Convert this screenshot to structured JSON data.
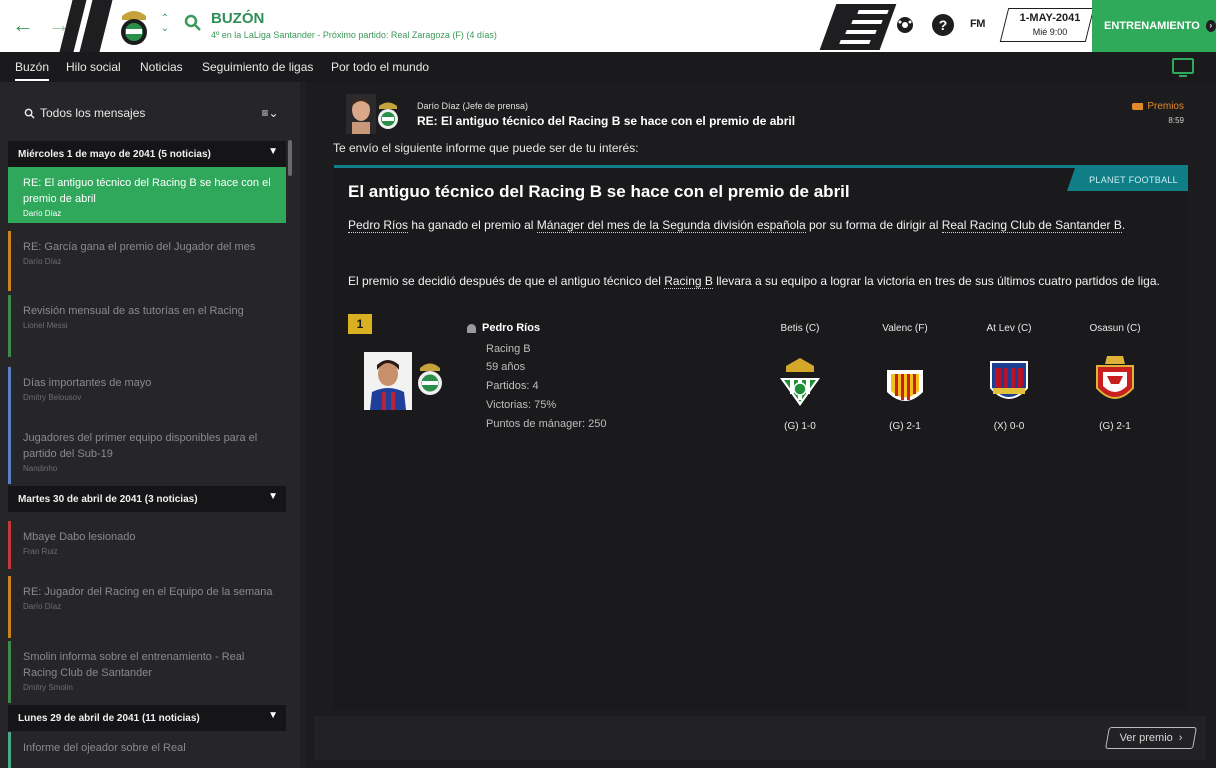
{
  "topbar": {
    "back_icon": "back-arrow-icon",
    "forward_icon": "forward-arrow-icon",
    "title": "BUZÓN",
    "subtitle": "4º en la LaLiga Santander - Próximo partido: Real Zaragoza (F) (4 días)",
    "fm_logo": "FM",
    "help_label": "?",
    "date": "1-MAY-2041",
    "day_time": "Mié 9:00",
    "continue_label": "ENTRENAMIENTO",
    "continue_icon": "›",
    "accent": "#2faa5a"
  },
  "subnav": {
    "tabs": [
      "Buzón",
      "Hilo social",
      "Noticias",
      "Seguimiento de ligas",
      "Por todo el mundo"
    ]
  },
  "inbox": {
    "filter_label": "Todos los mensajes",
    "filter_menu": "≡⌄",
    "groups": [
      {
        "label": "Miércoles 1 de mayo de 2041 (5 noticias)",
        "messages": [
          {
            "title": "RE: El antiguo técnico del Racing B se hace con el premio de abril",
            "sender": "Darío Díaz",
            "color": "#2fa85c"
          },
          {
            "title": "RE: García gana el premio del Jugador del mes",
            "sender": "Darío Díaz",
            "color": "#c9841f"
          },
          {
            "title": "Revisión mensual de as tutorías en el Racing",
            "sender": "Lionel Messi",
            "color": "#3e8a4a"
          },
          {
            "title": "Días importantes de mayo",
            "sender": "Dmitry Belousov",
            "color": "#5a7fc4"
          },
          {
            "title": "Jugadores del primer equipo disponibles para el partido del Sub-19",
            "sender": "Nandinho",
            "color": "#5a7fc4"
          }
        ]
      },
      {
        "label": "Martes 30 de abril de 2041 (3 noticias)",
        "messages": [
          {
            "title": "Mbaye Dabo lesionado",
            "sender": "Fran Ruiz",
            "color": "#c43a3a"
          },
          {
            "title": "RE: Jugador del Racing en el Equipo de la semana",
            "sender": "Darío Díaz",
            "color": "#c9841f"
          },
          {
            "title": "Smolin informa sobre el entrenamiento - Real Racing Club de Santander",
            "sender": "Dmitry Smolin",
            "color": "#3e8a4a"
          }
        ]
      },
      {
        "label": "Lunes 29 de abril de 2041 (11 noticias)",
        "messages": [
          {
            "title": "Informe del ojeador sobre el Real",
            "sender": "",
            "color": "#4aa888"
          }
        ]
      }
    ]
  },
  "message": {
    "sender": "Darío Díaz  (Jefe de prensa)",
    "subject": "RE: El antiguo técnico del Racing B se hace con el premio de abril",
    "tag": "Premios",
    "time": "8:59",
    "intro": "Te envío el siguiente informe que puede ser de tu interés:"
  },
  "article": {
    "source": "PLANET FOOTBALL",
    "headline": "El antiguo técnico del Racing B se hace con el premio de abril",
    "p1": {
      "name": "Pedro Ríos",
      "t1": " ha ganado el premio al ",
      "award": "Mánager del mes de la Segunda división española",
      "t2": " por su forma de dirigir al ",
      "club": "Real Racing Club de Santander B",
      "t3": "."
    },
    "p2": {
      "t1": "El premio se decidió después de que el antiguo técnico del ",
      "club": "Racing B",
      "t2": " llevara a su equipo a lograr la victoria en tres de sus últimos cuatro partidos de liga."
    },
    "rank": "1",
    "manager": {
      "name": "Pedro Ríos",
      "club": "Racing B",
      "age": "59 años",
      "matches": "Partidos: 4",
      "wins": "Victorias: 75%",
      "points": "Puntos de mánager: 250"
    },
    "matches": [
      {
        "opponent": "Betis (C)",
        "result": "(G) 1-0",
        "crest": "betis-crest-icon"
      },
      {
        "opponent": "Valenc (F)",
        "result": "(G) 2-1",
        "crest": "valencia-crest-icon"
      },
      {
        "opponent": "At Lev (C)",
        "result": "(X) 0-0",
        "crest": "levante-crest-icon"
      },
      {
        "opponent": "Osasun (C)",
        "result": "(G) 2-1",
        "crest": "osasuna-crest-icon"
      }
    ]
  },
  "footer": {
    "button_label": "Ver premio",
    "button_icon": "›"
  }
}
